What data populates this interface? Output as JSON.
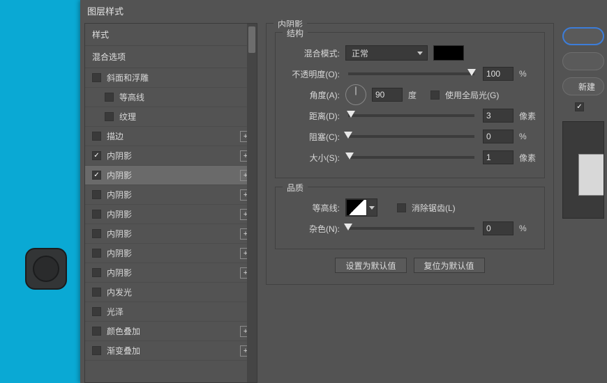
{
  "canvas": {
    "deco_name": "canvas-shape"
  },
  "dialog": {
    "title": "图层样式",
    "styles_header": "样式",
    "blend_options": "混合选项",
    "items": [
      {
        "label": "斜面和浮雕",
        "checked": false,
        "add": false,
        "indent": false
      },
      {
        "label": "等高线",
        "checked": false,
        "add": false,
        "indent": true
      },
      {
        "label": "纹理",
        "checked": false,
        "add": false,
        "indent": true
      },
      {
        "label": "描边",
        "checked": false,
        "add": true,
        "indent": false
      },
      {
        "label": "内阴影",
        "checked": true,
        "add": true,
        "indent": false,
        "selected": false
      },
      {
        "label": "内阴影",
        "checked": true,
        "add": true,
        "indent": false,
        "selected": true
      },
      {
        "label": "内阴影",
        "checked": false,
        "add": true,
        "indent": false
      },
      {
        "label": "内阴影",
        "checked": false,
        "add": true,
        "indent": false
      },
      {
        "label": "内阴影",
        "checked": false,
        "add": true,
        "indent": false
      },
      {
        "label": "内阴影",
        "checked": false,
        "add": true,
        "indent": false
      },
      {
        "label": "内阴影",
        "checked": false,
        "add": true,
        "indent": false
      },
      {
        "label": "内发光",
        "checked": false,
        "add": false,
        "indent": false
      },
      {
        "label": "光泽",
        "checked": false,
        "add": false,
        "indent": false
      },
      {
        "label": "颜色叠加",
        "checked": false,
        "add": true,
        "indent": false
      },
      {
        "label": "渐变叠加",
        "checked": false,
        "add": true,
        "indent": false
      }
    ]
  },
  "panel": {
    "section_title": "内阴影",
    "structure_title": "结构",
    "quality_title": "品质",
    "blend_mode_label": "混合模式:",
    "blend_mode_value": "正常",
    "opacity_label": "不透明度(O):",
    "opacity_value": "100",
    "opacity_unit": "%",
    "angle_label": "角度(A):",
    "angle_value": "90",
    "angle_unit": "度",
    "global_light_label": "使用全局光(G)",
    "distance_label": "距离(D):",
    "distance_value": "3",
    "distance_unit": "像素",
    "choke_label": "阻塞(C):",
    "choke_value": "0",
    "choke_unit": "%",
    "size_label": "大小(S):",
    "size_value": "1",
    "size_unit": "像素",
    "contour_label": "等高线:",
    "antialias_label": "消除锯齿(L)",
    "noise_label": "杂色(N):",
    "noise_value": "0",
    "noise_unit": "%",
    "make_default": "设置为默认值",
    "reset_default": "复位为默认值"
  },
  "right": {
    "new_style": "新建",
    "preview_check": true
  }
}
